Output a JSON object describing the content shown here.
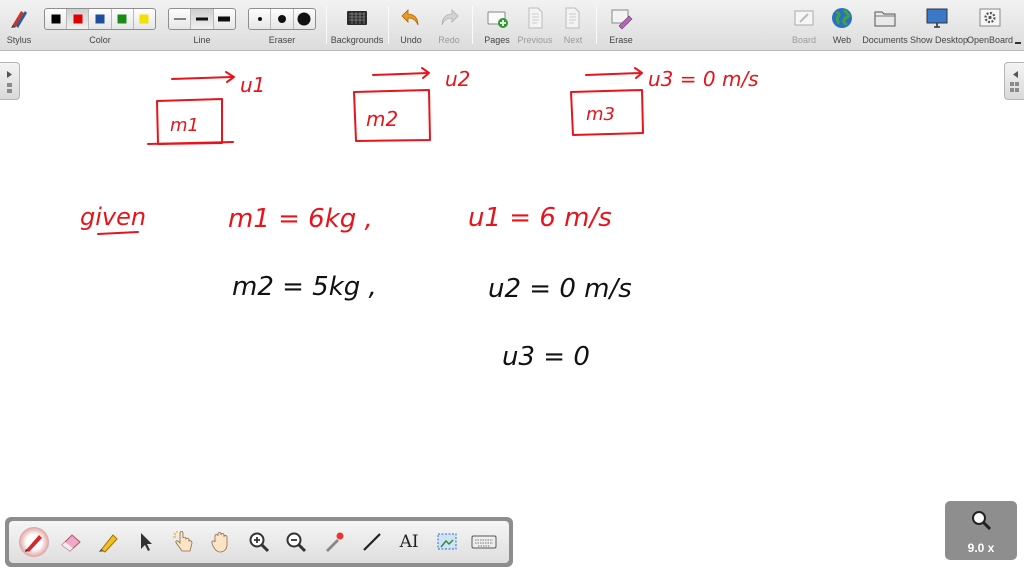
{
  "toolbar": {
    "stylus": "Stylus",
    "color": "Color",
    "line": "Line",
    "eraser": "Eraser",
    "backgrounds": "Backgrounds",
    "undo": "Undo",
    "redo": "Redo",
    "pages": "Pages",
    "previous": "Previous",
    "next": "Next",
    "erase": "Erase",
    "board": "Board",
    "web": "Web",
    "documents": "Documents",
    "show_desktop": "Show Desktop",
    "openboard": "OpenBoard",
    "colors": [
      "#000000",
      "#e00000",
      "#1d4f9c",
      "#1a8a1a",
      "#f2e000"
    ],
    "selected_color_index": 1
  },
  "board": {
    "ink_color_red": "#e8141c",
    "ink_color_black": "#111111",
    "diagram": {
      "block1_label": "m1",
      "block2_label": "m2",
      "block3_label": "m3",
      "arrow1_label": "u1",
      "arrow2_label": "u2",
      "arrow3_label": "u3 = 0 m/s"
    },
    "notes": {
      "given": "given",
      "m1": "m1 = 6kg ,",
      "u1": "u1 = 6 m/s",
      "m2": "m2 = 5kg ,",
      "u2": "u2 = 0 m/s",
      "u3": "u3 = 0"
    }
  },
  "dock": {
    "ai_label": "AI"
  },
  "zoom": {
    "value": "9.0 x"
  }
}
